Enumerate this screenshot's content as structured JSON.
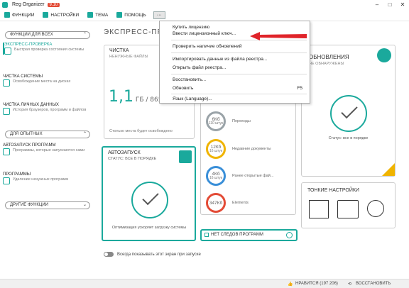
{
  "window": {
    "title": "Reg Organizer",
    "version": "9.10",
    "controls": [
      "–",
      "□",
      "✕"
    ]
  },
  "menubar": [
    {
      "label": "ФУНКЦИИ",
      "icon": "grid-icon"
    },
    {
      "label": "НАСТРОЙКИ",
      "icon": "gear-icon"
    },
    {
      "label": "ТЕМА",
      "icon": "palette-icon"
    },
    {
      "label": "ПОМОЩЬ",
      "icon": "help-icon"
    }
  ],
  "more_label": "···",
  "sidebar": {
    "section1": "ФУНКЦИИ ДЛЯ ВСЕХ",
    "section2": "ДЛЯ ОПЫТНЫХ",
    "section3": "ДРУГИЕ ФУНКЦИИ",
    "items": [
      {
        "title": "ЭКСПРЕСС-ПРОВЕРКА",
        "desc": "Быстрая проверка состояния системы"
      },
      {
        "title": "ЧИСТКА СИСТЕМЫ",
        "desc": "Освобождение места на дисках"
      },
      {
        "title": "ЧИСТКА ЛИЧНЫХ ДАННЫХ",
        "desc": "История браузеров, программ и файлов"
      },
      {
        "title": "АВТОЗАПУСК ПРОГРАММ",
        "desc": "Программы, которые запускаются сами"
      },
      {
        "title": "ПРОГРАММЫ",
        "desc": "Удаление ненужных программ"
      }
    ]
  },
  "page_title": "ЭКСПРЕСС-ПРОВЕРКА",
  "cards": {
    "cleanup": {
      "title": "ЧИСТКА",
      "subtitle": "НЕНУЖНЫЕ ФАЙЛЫ",
      "big_value": "1,1",
      "big_unit": "ГБ / 865 штук",
      "footer": "Столько места будет освобождено"
    },
    "autostart": {
      "title": "АВТОЗАПУСК",
      "subtitle": "СТАТУС: ВСЕ В ПОРЯДКЕ",
      "footer": "Оптимизация ускоряет загрузку системы"
    },
    "updates": {
      "title": "ОБНОВЛЕНИЯ",
      "subtitle": "НЕ ОБНАРУЖЕНЫ",
      "footer": "Статус: все в порядке"
    },
    "tweaks": {
      "title": "ТОНКИЕ НАСТРОЙКИ"
    },
    "traces": {
      "title": "НЕТ СЛЕДОВ ПРОГРАММ"
    }
  },
  "stats": [
    {
      "value": "6Кб",
      "unit": "110 штук",
      "label": "Переходы",
      "color": "#9aa3a8"
    },
    {
      "value": "12Кб",
      "unit": "16 штук",
      "label": "Недавние документы",
      "color": "#f0b400"
    },
    {
      "value": "4Кб",
      "unit": "16 штук",
      "label": "Ранее открытые фай...",
      "color": "#3a8fd8"
    },
    {
      "value": "347Кб",
      "unit": "",
      "label": "Elements",
      "color": "#e34b36"
    }
  ],
  "dropdown": {
    "items": [
      {
        "label": "Купить лицензию",
        "shortcut": ""
      },
      {
        "label": "Ввести лицензионный ключ...",
        "shortcut": ""
      },
      {
        "label": "Проверить наличие обновлений",
        "shortcut": ""
      },
      {
        "label": "Импортировать данные из файла реестра...",
        "shortcut": ""
      },
      {
        "label": "Открыть файл реестра...",
        "shortcut": ""
      },
      {
        "label": "Восстановить...",
        "shortcut": ""
      },
      {
        "label": "Обновить",
        "shortcut": "F5"
      },
      {
        "label": "Язык (Language)...",
        "shortcut": ""
      }
    ]
  },
  "bottom_toggle": "Всегда показывать этот экран при запуске",
  "statusbar": {
    "likes": "НРАВИТСЯ (197 206)",
    "restore": "ВОССТАНОВИТЬ"
  },
  "colors": {
    "accent": "#1aa99c",
    "arrow": "#e0242a"
  }
}
